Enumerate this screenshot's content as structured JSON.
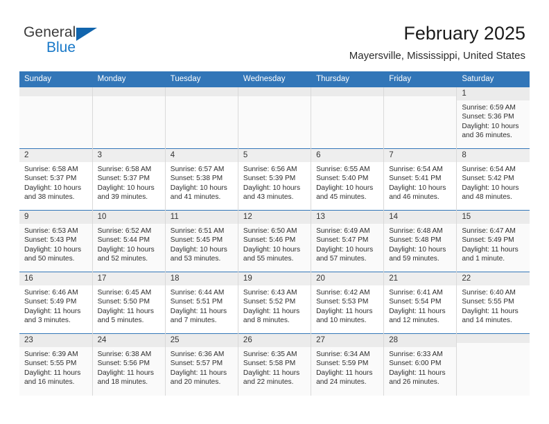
{
  "brand": {
    "name_top": "General",
    "name_bottom": "Blue",
    "logo_icon": "triangle-icon",
    "color_blue": "#1878c8",
    "color_triangle": "#1165ad"
  },
  "header": {
    "title": "February 2025",
    "subtitle": "Mayersville, Mississippi, United States",
    "accent_color": "#3276b8"
  },
  "calendar": {
    "weekday_headers": [
      "Sunday",
      "Monday",
      "Tuesday",
      "Wednesday",
      "Thursday",
      "Friday",
      "Saturday"
    ],
    "weeks": [
      [
        {
          "day": "",
          "lines": []
        },
        {
          "day": "",
          "lines": []
        },
        {
          "day": "",
          "lines": []
        },
        {
          "day": "",
          "lines": []
        },
        {
          "day": "",
          "lines": []
        },
        {
          "day": "",
          "lines": []
        },
        {
          "day": "1",
          "lines": [
            "Sunrise: 6:59 AM",
            "Sunset: 5:36 PM",
            "Daylight: 10 hours",
            "and 36 minutes."
          ]
        }
      ],
      [
        {
          "day": "2",
          "lines": [
            "Sunrise: 6:58 AM",
            "Sunset: 5:37 PM",
            "Daylight: 10 hours",
            "and 38 minutes."
          ]
        },
        {
          "day": "3",
          "lines": [
            "Sunrise: 6:58 AM",
            "Sunset: 5:37 PM",
            "Daylight: 10 hours",
            "and 39 minutes."
          ]
        },
        {
          "day": "4",
          "lines": [
            "Sunrise: 6:57 AM",
            "Sunset: 5:38 PM",
            "Daylight: 10 hours",
            "and 41 minutes."
          ]
        },
        {
          "day": "5",
          "lines": [
            "Sunrise: 6:56 AM",
            "Sunset: 5:39 PM",
            "Daylight: 10 hours",
            "and 43 minutes."
          ]
        },
        {
          "day": "6",
          "lines": [
            "Sunrise: 6:55 AM",
            "Sunset: 5:40 PM",
            "Daylight: 10 hours",
            "and 45 minutes."
          ]
        },
        {
          "day": "7",
          "lines": [
            "Sunrise: 6:54 AM",
            "Sunset: 5:41 PM",
            "Daylight: 10 hours",
            "and 46 minutes."
          ]
        },
        {
          "day": "8",
          "lines": [
            "Sunrise: 6:54 AM",
            "Sunset: 5:42 PM",
            "Daylight: 10 hours",
            "and 48 minutes."
          ]
        }
      ],
      [
        {
          "day": "9",
          "lines": [
            "Sunrise: 6:53 AM",
            "Sunset: 5:43 PM",
            "Daylight: 10 hours",
            "and 50 minutes."
          ]
        },
        {
          "day": "10",
          "lines": [
            "Sunrise: 6:52 AM",
            "Sunset: 5:44 PM",
            "Daylight: 10 hours",
            "and 52 minutes."
          ]
        },
        {
          "day": "11",
          "lines": [
            "Sunrise: 6:51 AM",
            "Sunset: 5:45 PM",
            "Daylight: 10 hours",
            "and 53 minutes."
          ]
        },
        {
          "day": "12",
          "lines": [
            "Sunrise: 6:50 AM",
            "Sunset: 5:46 PM",
            "Daylight: 10 hours",
            "and 55 minutes."
          ]
        },
        {
          "day": "13",
          "lines": [
            "Sunrise: 6:49 AM",
            "Sunset: 5:47 PM",
            "Daylight: 10 hours",
            "and 57 minutes."
          ]
        },
        {
          "day": "14",
          "lines": [
            "Sunrise: 6:48 AM",
            "Sunset: 5:48 PM",
            "Daylight: 10 hours",
            "and 59 minutes."
          ]
        },
        {
          "day": "15",
          "lines": [
            "Sunrise: 6:47 AM",
            "Sunset: 5:49 PM",
            "Daylight: 11 hours",
            "and 1 minute."
          ]
        }
      ],
      [
        {
          "day": "16",
          "lines": [
            "Sunrise: 6:46 AM",
            "Sunset: 5:49 PM",
            "Daylight: 11 hours",
            "and 3 minutes."
          ]
        },
        {
          "day": "17",
          "lines": [
            "Sunrise: 6:45 AM",
            "Sunset: 5:50 PM",
            "Daylight: 11 hours",
            "and 5 minutes."
          ]
        },
        {
          "day": "18",
          "lines": [
            "Sunrise: 6:44 AM",
            "Sunset: 5:51 PM",
            "Daylight: 11 hours",
            "and 7 minutes."
          ]
        },
        {
          "day": "19",
          "lines": [
            "Sunrise: 6:43 AM",
            "Sunset: 5:52 PM",
            "Daylight: 11 hours",
            "and 8 minutes."
          ]
        },
        {
          "day": "20",
          "lines": [
            "Sunrise: 6:42 AM",
            "Sunset: 5:53 PM",
            "Daylight: 11 hours",
            "and 10 minutes."
          ]
        },
        {
          "day": "21",
          "lines": [
            "Sunrise: 6:41 AM",
            "Sunset: 5:54 PM",
            "Daylight: 11 hours",
            "and 12 minutes."
          ]
        },
        {
          "day": "22",
          "lines": [
            "Sunrise: 6:40 AM",
            "Sunset: 5:55 PM",
            "Daylight: 11 hours",
            "and 14 minutes."
          ]
        }
      ],
      [
        {
          "day": "23",
          "lines": [
            "Sunrise: 6:39 AM",
            "Sunset: 5:55 PM",
            "Daylight: 11 hours",
            "and 16 minutes."
          ]
        },
        {
          "day": "24",
          "lines": [
            "Sunrise: 6:38 AM",
            "Sunset: 5:56 PM",
            "Daylight: 11 hours",
            "and 18 minutes."
          ]
        },
        {
          "day": "25",
          "lines": [
            "Sunrise: 6:36 AM",
            "Sunset: 5:57 PM",
            "Daylight: 11 hours",
            "and 20 minutes."
          ]
        },
        {
          "day": "26",
          "lines": [
            "Sunrise: 6:35 AM",
            "Sunset: 5:58 PM",
            "Daylight: 11 hours",
            "and 22 minutes."
          ]
        },
        {
          "day": "27",
          "lines": [
            "Sunrise: 6:34 AM",
            "Sunset: 5:59 PM",
            "Daylight: 11 hours",
            "and 24 minutes."
          ]
        },
        {
          "day": "28",
          "lines": [
            "Sunrise: 6:33 AM",
            "Sunset: 6:00 PM",
            "Daylight: 11 hours",
            "and 26 minutes."
          ]
        },
        {
          "day": "",
          "lines": []
        }
      ]
    ]
  }
}
